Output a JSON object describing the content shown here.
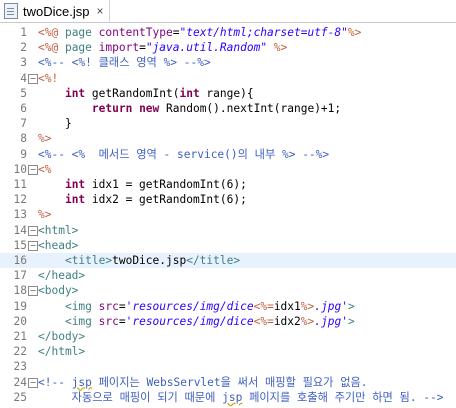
{
  "tab": {
    "filename": "twoDice.jsp",
    "close_icon": "×"
  },
  "editor": {
    "current_line": 16,
    "colors": {
      "default": "#000000",
      "jsp_delim": "#bf5f3f",
      "directive": "#3f7f7f",
      "attr_name": "#7f007f",
      "attr_value": "#2a00ff",
      "keyword": "#7f0055",
      "comment": "#3f5fbf",
      "tag": "#3f7f7f",
      "linenum": "#787878",
      "current_line_bg": "#e8f2fe"
    },
    "lines": [
      {
        "n": "1",
        "fold": "",
        "toks": [
          [
            "<%@ ",
            "jsp_delim"
          ],
          [
            "page ",
            "directive"
          ],
          [
            "contentType",
            "attr_name"
          ],
          [
            "=",
            "default"
          ],
          [
            "\"text/html;charset=utf-8\"",
            "attr_value"
          ],
          [
            "%>",
            "jsp_delim"
          ]
        ]
      },
      {
        "n": "2",
        "fold": "",
        "toks": [
          [
            "<%@ ",
            "jsp_delim"
          ],
          [
            "page ",
            "directive"
          ],
          [
            "import",
            "attr_name"
          ],
          [
            "=",
            "default"
          ],
          [
            "\"java.util.Random\"",
            "attr_value"
          ],
          [
            " %>",
            "jsp_delim"
          ]
        ]
      },
      {
        "n": "3",
        "fold": "",
        "toks": [
          [
            "<%-- <%! 클래스 영역 %> --%>",
            "comment"
          ]
        ]
      },
      {
        "n": "4",
        "fold": "−",
        "toks": [
          [
            "<%!",
            "jsp_delim"
          ]
        ]
      },
      {
        "n": "5",
        "fold": "",
        "toks": [
          [
            "    ",
            "default"
          ],
          [
            "int",
            "keyword"
          ],
          [
            " getRandomInt(",
            "default"
          ],
          [
            "int",
            "keyword"
          ],
          [
            " range){",
            "default"
          ]
        ]
      },
      {
        "n": "6",
        "fold": "",
        "toks": [
          [
            "        ",
            "default"
          ],
          [
            "return",
            "keyword"
          ],
          [
            " ",
            "default"
          ],
          [
            "new",
            "keyword"
          ],
          [
            " Random().nextInt(range)+1;",
            "default"
          ]
        ]
      },
      {
        "n": "7",
        "fold": "",
        "toks": [
          [
            "    }",
            "default"
          ]
        ]
      },
      {
        "n": "8",
        "fold": "",
        "toks": [
          [
            "%>",
            "jsp_delim"
          ]
        ]
      },
      {
        "n": "9",
        "fold": "",
        "toks": [
          [
            "<%-- <%  메서드 영역 - service()의 내부 %> --%>",
            "comment"
          ]
        ]
      },
      {
        "n": "10",
        "fold": "−",
        "toks": [
          [
            "<%",
            "jsp_delim"
          ]
        ]
      },
      {
        "n": "11",
        "fold": "",
        "toks": [
          [
            "    ",
            "default"
          ],
          [
            "int",
            "keyword"
          ],
          [
            " idx1 = getRandomInt(6);",
            "default"
          ]
        ]
      },
      {
        "n": "12",
        "fold": "",
        "toks": [
          [
            "    ",
            "default"
          ],
          [
            "int",
            "keyword"
          ],
          [
            " idx2 = getRandomInt(6);",
            "default"
          ]
        ]
      },
      {
        "n": "13",
        "fold": "",
        "toks": [
          [
            "%>",
            "jsp_delim"
          ]
        ]
      },
      {
        "n": "14",
        "fold": "−",
        "toks": [
          [
            "<html>",
            "tag"
          ]
        ]
      },
      {
        "n": "15",
        "fold": "−",
        "toks": [
          [
            "<head>",
            "tag"
          ]
        ]
      },
      {
        "n": "16",
        "fold": "",
        "toks": [
          [
            "    ",
            "default"
          ],
          [
            "<title>",
            "tag"
          ],
          [
            "twoDice.jsp",
            "default"
          ],
          [
            "</title>",
            "tag"
          ]
        ]
      },
      {
        "n": "17",
        "fold": "",
        "toks": [
          [
            "</head>",
            "tag"
          ]
        ]
      },
      {
        "n": "18",
        "fold": "−",
        "toks": [
          [
            "<body>",
            "tag"
          ]
        ]
      },
      {
        "n": "19",
        "fold": "",
        "toks": [
          [
            "    ",
            "default"
          ],
          [
            "<img ",
            "tag"
          ],
          [
            "src",
            "attr_name"
          ],
          [
            "=",
            "default"
          ],
          [
            "'resources/img/dice",
            "attr_value"
          ],
          [
            "<%=",
            "jsp_delim"
          ],
          [
            "idx1",
            "default"
          ],
          [
            "%>",
            "jsp_delim"
          ],
          [
            ".jpg'",
            "attr_value"
          ],
          [
            ">",
            "tag"
          ]
        ]
      },
      {
        "n": "20",
        "fold": "",
        "toks": [
          [
            "    ",
            "default"
          ],
          [
            "<img ",
            "tag"
          ],
          [
            "src",
            "attr_name"
          ],
          [
            "=",
            "default"
          ],
          [
            "'resources/img/dice",
            "attr_value"
          ],
          [
            "<%=",
            "jsp_delim"
          ],
          [
            "idx2",
            "default"
          ],
          [
            "%>",
            "jsp_delim"
          ],
          [
            ".jpg'",
            "attr_value"
          ],
          [
            ">",
            "tag"
          ]
        ]
      },
      {
        "n": "21",
        "fold": "",
        "toks": [
          [
            "</body>",
            "tag"
          ]
        ]
      },
      {
        "n": "22",
        "fold": "",
        "toks": [
          [
            "</html>",
            "tag"
          ]
        ]
      },
      {
        "n": "23",
        "fold": "",
        "toks": []
      },
      {
        "n": "24",
        "fold": "−",
        "toks": [
          [
            "<!-- ",
            "comment"
          ],
          [
            "jsp",
            "comment_warn"
          ],
          [
            " 페이지는 WebsServlet을 써서 매핑할 필요가 없음.",
            "comment"
          ]
        ]
      },
      {
        "n": "25",
        "fold": "",
        "toks": [
          [
            "     자동으로 매핑이 되기 때문에 ",
            "comment"
          ],
          [
            "jsp",
            "comment_warn"
          ],
          [
            " 페이지를 호출해 주기만 하면 됨. -->",
            "comment"
          ]
        ]
      }
    ]
  }
}
